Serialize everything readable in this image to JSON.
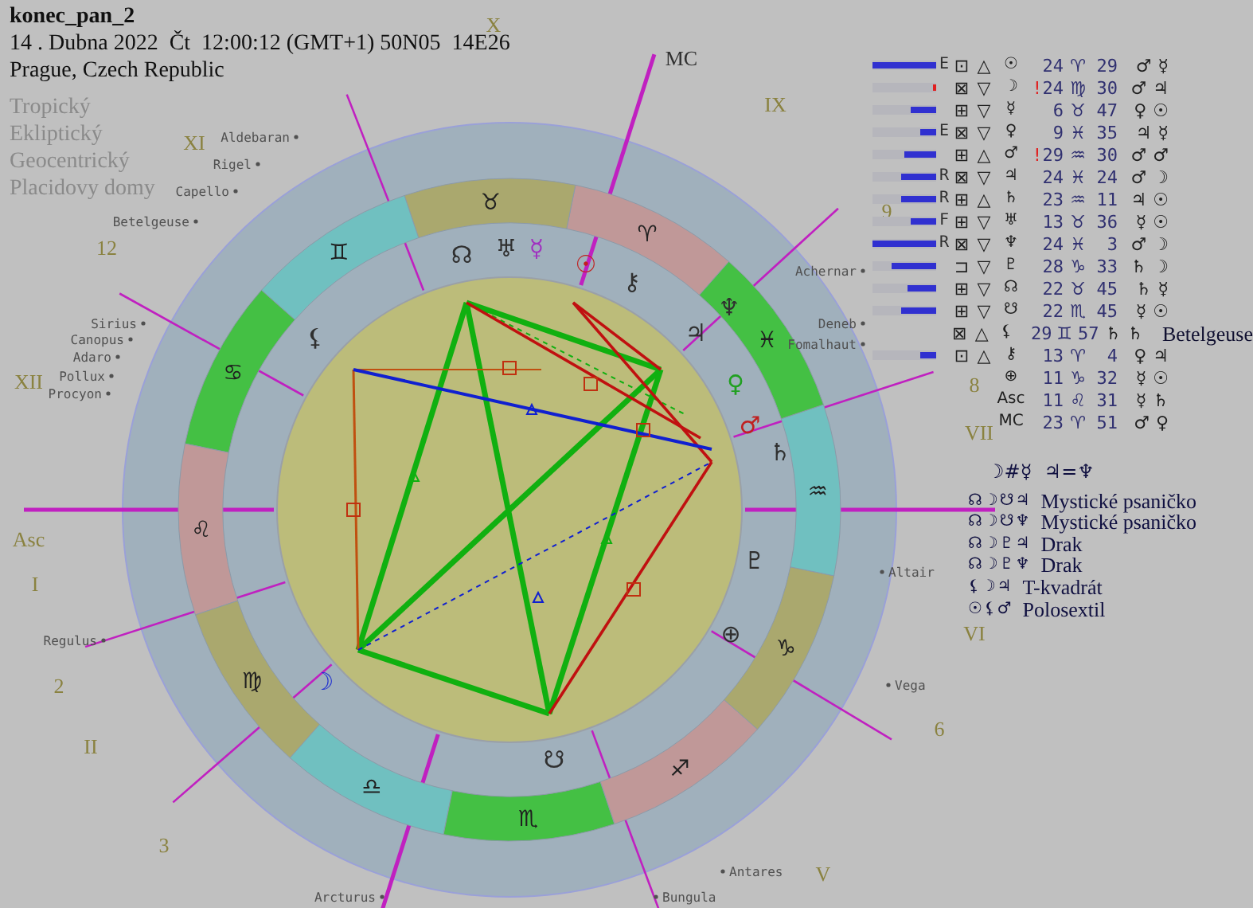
{
  "chart_name": "konec_pan_2",
  "datetime": "14 . Dubna 2022  Čt  12:00:12 (GMT+1) 50N05  14E26",
  "place": "Prague, Czech Republic",
  "settings": [
    "Tropický",
    "Ekliptický",
    "Geocentrický",
    "Placidovy domy"
  ],
  "wheel": {
    "signs": [
      {
        "glyph": "♈",
        "color": "#c09898"
      },
      {
        "glyph": "♉",
        "color": "#aaa86e"
      },
      {
        "glyph": "♊",
        "color": "#70c0c0"
      },
      {
        "glyph": "♋",
        "color": "#44c044"
      },
      {
        "glyph": "♌",
        "color": "#c09898"
      },
      {
        "glyph": "♍",
        "color": "#aaa86e"
      },
      {
        "glyph": "♎",
        "color": "#70c0c0"
      },
      {
        "glyph": "♏",
        "color": "#44c044"
      },
      {
        "glyph": "♐",
        "color": "#c09898"
      },
      {
        "glyph": "♑",
        "color": "#aaa86e"
      },
      {
        "glyph": "♒",
        "color": "#70c0c0"
      },
      {
        "glyph": "♓",
        "color": "#44c044"
      }
    ],
    "house_labels": [
      "X",
      "MC",
      "IX",
      "XI",
      "9",
      "12",
      "XII",
      "8",
      "VII",
      "Asc",
      "I",
      "VI",
      "2",
      "6",
      "II",
      "3",
      "V"
    ],
    "stars": [
      "Aldebaran",
      "Rigel",
      "Capello",
      "Betelgeuse",
      "Sirius",
      "Canopus",
      "Adaro",
      "Pollux",
      "Procyon",
      "Regulus",
      "Arcturus",
      "Bungula",
      "Antares",
      "Vega",
      "Altair",
      "Achernar",
      "Deneb",
      "Fomalhaut"
    ],
    "planets": [
      {
        "glyph": "☊",
        "color": "#303030"
      },
      {
        "glyph": "♅",
        "color": "#303030"
      },
      {
        "glyph": "☿",
        "color": "#a030c0"
      },
      {
        "glyph": "☉",
        "color": "#c02020"
      },
      {
        "glyph": "⚷",
        "color": "#303030"
      },
      {
        "glyph": "♆",
        "color": "#303030"
      },
      {
        "glyph": "♃",
        "color": "#303030"
      },
      {
        "glyph": "♀",
        "color": "#20a020"
      },
      {
        "glyph": "♂",
        "color": "#c02020"
      },
      {
        "glyph": "♄",
        "color": "#303030"
      },
      {
        "glyph": "♇",
        "color": "#303030"
      },
      {
        "glyph": "⊕",
        "color": "#303030"
      },
      {
        "glyph": "☋",
        "color": "#303030"
      },
      {
        "glyph": "☽",
        "color": "#2030d0"
      },
      {
        "glyph": "⚸",
        "color": "#303030"
      }
    ]
  },
  "positions": [
    {
      "bar": {
        "level": 1,
        "color": "#3030d0"
      },
      "motion": "E",
      "aspects": [
        "⊡",
        "△"
      ],
      "glyph": "☉",
      "degree": "24",
      "sign": "♈",
      "minute": "29",
      "rulers": [
        "♂",
        "☿"
      ]
    },
    {
      "bar": {
        "level": 0.05,
        "color": "#e02020"
      },
      "aspects": [
        "⊠",
        "▽"
      ],
      "glyph": "☽",
      "alert": "!",
      "degree": "24",
      "sign": "♍",
      "minute": "30",
      "rulers": [
        "♂",
        "♃"
      ]
    },
    {
      "bar": {
        "level": 0.4,
        "color": "#3030d0"
      },
      "aspects": [
        "⊞",
        "▽"
      ],
      "glyph": "☿",
      "degree": "6",
      "sign": "♉",
      "minute": "47",
      "rulers": [
        "♀",
        "☉"
      ]
    },
    {
      "bar": {
        "level": 0.25,
        "color": "#3030d0"
      },
      "motion": "E",
      "aspects": [
        "⊠",
        "▽"
      ],
      "glyph": "♀",
      "degree": "9",
      "sign": "♓",
      "minute": "35",
      "rulers": [
        "♃",
        "☿"
      ]
    },
    {
      "bar": {
        "level": 0.5,
        "color": "#3030d0"
      },
      "aspects": [
        "⊞",
        "△"
      ],
      "glyph": "♂",
      "alert": "!",
      "degree": "29",
      "sign": "♒",
      "minute": "30",
      "rulers": [
        "♂",
        "♂"
      ]
    },
    {
      "bar": {
        "level": 0.55,
        "color": "#3030d0"
      },
      "motion": "R",
      "aspects": [
        "⊠",
        "▽"
      ],
      "glyph": "♃",
      "degree": "24",
      "sign": "♓",
      "minute": "24",
      "rulers": [
        "♂",
        "☽"
      ]
    },
    {
      "bar": {
        "level": 0.55,
        "color": "#3030d0"
      },
      "motion": "R",
      "aspects": [
        "⊞",
        "△"
      ],
      "glyph": "♄",
      "degree": "23",
      "sign": "♒",
      "minute": "11",
      "rulers": [
        "♃",
        "☉"
      ]
    },
    {
      "bar": {
        "level": 0.4,
        "color": "#3030d0"
      },
      "motion": "F",
      "aspects": [
        "⊞",
        "▽"
      ],
      "glyph": "♅",
      "degree": "13",
      "sign": "♉",
      "minute": "36",
      "rulers": [
        "☿",
        "☉"
      ]
    },
    {
      "bar": {
        "level": 1,
        "color": "#3030d0"
      },
      "motion": "R",
      "aspects": [
        "⊠",
        "▽"
      ],
      "glyph": "♆",
      "degree": "24",
      "sign": "♓",
      "minute": "3",
      "rulers": [
        "♂",
        "☽"
      ]
    },
    {
      "bar": {
        "level": 0.7,
        "color": "#3030d0"
      },
      "aspects": [
        "⊐",
        "▽"
      ],
      "glyph": "♇",
      "degree": "28",
      "sign": "♑",
      "minute": "33",
      "rulers": [
        "♄",
        "☽"
      ]
    },
    {
      "bar": {
        "level": 0.45,
        "color": "#3030d0"
      },
      "aspects": [
        "⊞",
        "▽"
      ],
      "glyph": "☊",
      "degree": "22",
      "sign": "♉",
      "minute": "45",
      "rulers": [
        "♄",
        "☿"
      ]
    },
    {
      "bar": {
        "level": 0.55,
        "color": "#3030d0"
      },
      "aspects": [
        "⊞",
        "▽"
      ],
      "glyph": "☋",
      "degree": "22",
      "sign": "♏",
      "minute": "45",
      "rulers": [
        "☿",
        "☉"
      ]
    },
    {
      "aspects": [
        "⊠",
        "△"
      ],
      "glyph": "⚸",
      "degree": "29",
      "sign": "♊",
      "minute": "57",
      "rulers": [
        "♄",
        "♄"
      ],
      "note": "Betelgeuse"
    },
    {
      "bar": {
        "level": 0.25,
        "color": "#3030d0"
      },
      "aspects": [
        "⊡",
        "△"
      ],
      "glyph": "⚷",
      "degree": "13",
      "sign": "♈",
      "minute": "4",
      "rulers": [
        "♀",
        "♃"
      ]
    },
    {
      "glyph": "⊕",
      "degree": "11",
      "sign": "♑",
      "minute": "32",
      "rulers": [
        "☿",
        "☉"
      ]
    },
    {
      "glyph": "Asc",
      "degree": "11",
      "sign": "♌",
      "minute": "31",
      "rulers": [
        "☿",
        "♄"
      ]
    },
    {
      "glyph": "MC",
      "degree": "23",
      "sign": "♈",
      "minute": "51",
      "rulers": [
        "♂",
        "♀"
      ]
    }
  ],
  "aspect_formula": "☽#☿  ♃=♆",
  "patterns": [
    {
      "glyphs": "☊☽☋♃",
      "name": "Mystické psaničko"
    },
    {
      "glyphs": "☊☽☋♆",
      "name": "Mystické psaničko"
    },
    {
      "glyphs": "☊☽♇♃",
      "name": "Drak"
    },
    {
      "glyphs": "☊☽♇♆",
      "name": "Drak"
    },
    {
      "glyphs": "⚸☽♃",
      "name": "T-kvadrát"
    },
    {
      "glyphs": "☉⚸♂",
      "name": "Polosextil"
    }
  ]
}
